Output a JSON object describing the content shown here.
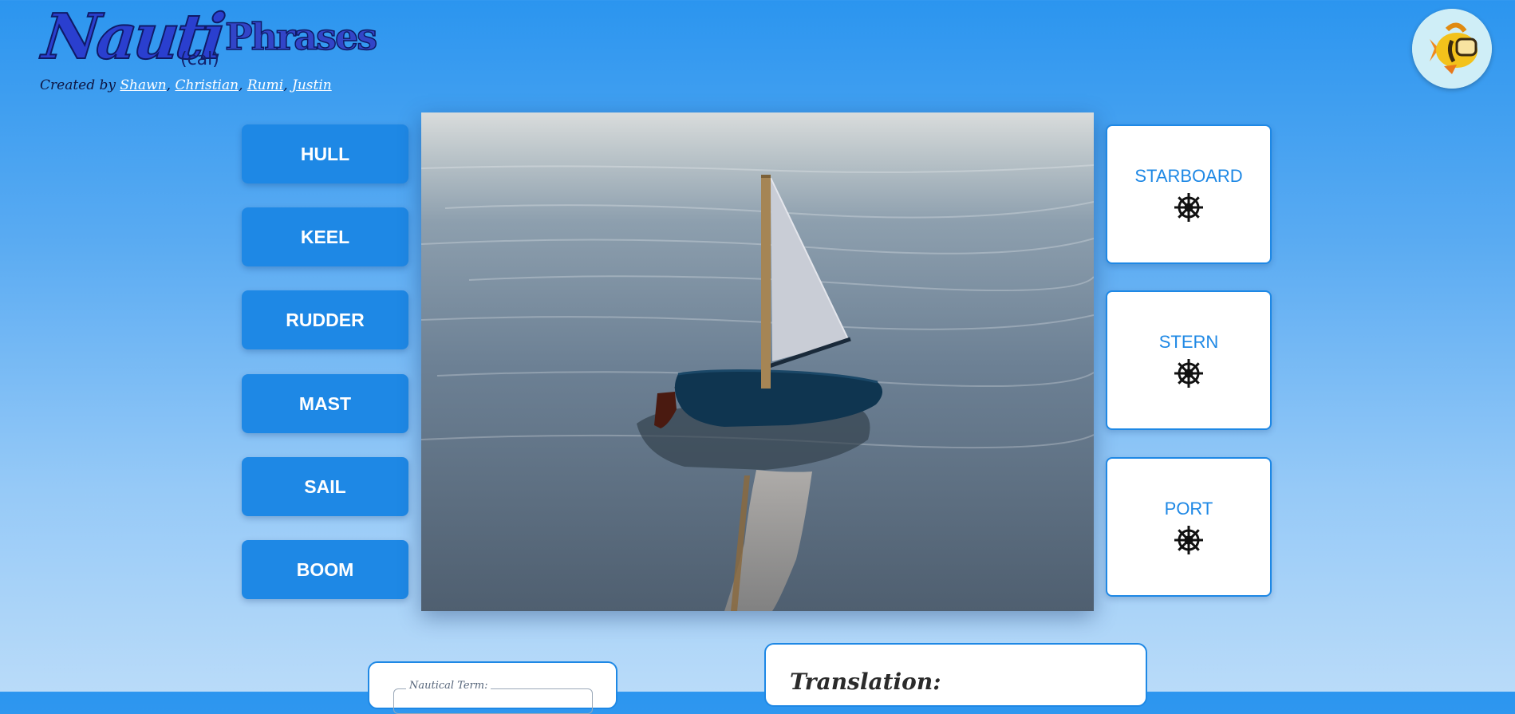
{
  "header": {
    "logo": {
      "main": "Nauti",
      "middle": "(cal)",
      "end": "Phrases"
    },
    "credits_prefix": "Created by ",
    "authors": [
      "Shawn",
      "Christian",
      "Rumi",
      "Justin"
    ],
    "author_separator": ","
  },
  "avatar": {
    "icon": "fish-mascot-icon"
  },
  "parts": [
    "HULL",
    "KEEL",
    "RUDDER",
    "MAST",
    "SAIL",
    "BOOM"
  ],
  "directions": [
    {
      "label": "STARBOARD",
      "icon": "ship-wheel-icon"
    },
    {
      "label": "STERN",
      "icon": "ship-wheel-icon"
    },
    {
      "label": "PORT",
      "icon": "ship-wheel-icon"
    }
  ],
  "term_panel": {
    "legend": "Nautical Term:"
  },
  "translation_panel": {
    "title": "Translation:"
  },
  "colors": {
    "accent": "#1e88e5",
    "hull": "#0f3550",
    "mast": "#a58555",
    "sail": "#c9cdd6",
    "sea": "#6d8195"
  }
}
